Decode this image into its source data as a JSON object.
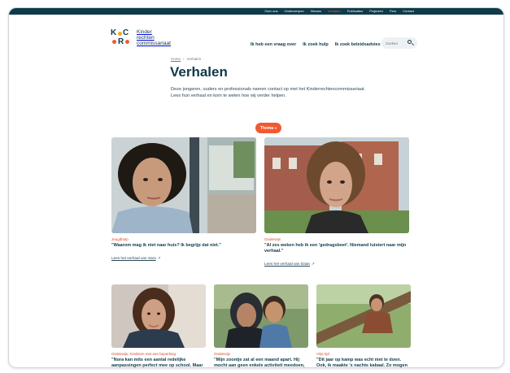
{
  "topbar": {
    "links": [
      "Over ons",
      "Onderwerpen",
      "Nieuws",
      "Verhalen",
      "Publicaties",
      "Projecten",
      "Pers",
      "Contact"
    ],
    "active_index": 3
  },
  "logo": {
    "line1": "Kinder",
    "line2": "rechten",
    "line3": "commissariaat"
  },
  "mainnav": {
    "items": [
      "Ik heb een vraag over",
      "Ik zoek hulp",
      "Ik zoek beleidsadvies"
    ]
  },
  "search": {
    "placeholder": "Zoeken",
    "icon": "search-icon"
  },
  "breadcrumb": {
    "home": "Home",
    "separator": "›",
    "current": "Verhalen"
  },
  "page": {
    "title": "Verhalen",
    "intro": "Deze jongeren, ouders en professionals namen contact op met het Kinderrechtencommissariaat. Lees hun verhaal en kom te weten hoe wij verder helpen."
  },
  "filter": {
    "label": "Thema",
    "chevron": "chevron-down-icon"
  },
  "stories": [
    {
      "tag": "Jeugdhulp",
      "quote": "\"Waarom mag ik niet naar huis? Ik begrijp dat niet.\"",
      "link": "Lees het verhaal van Sara"
    },
    {
      "tag": "Onderwijs",
      "quote": "\"Al zes weken heb ik een 'gedragsbeet'. Niemand luistert naar mijn verhaal.\"",
      "link": "Lees het verhaal van Daan"
    },
    {
      "tag": "Onderwijs, Kinderen met een beperking",
      "quote": "\"Nora kan mits een aantal redelijke aanpassingen perfect mee op school. Maar toch botsen we op onbegrip.\""
    },
    {
      "tag": "Onderwijs",
      "quote": "\"Mijn zoontje zat al een maand apart. Hij mocht aan geen enkele activiteit meedoen, dat kan toch niet?\""
    },
    {
      "tag": "Vrije tijd",
      "quote": "\"Dit jaar op kamp was echt niet te doen. Ook, ik maakte 's nachts kabaal. Zo mogen mij ook straffen maar dit was er echt"
    }
  ],
  "colors": {
    "navy": "#0f3a4a",
    "accent": "#f15a31",
    "tag": "#d94a2b"
  }
}
